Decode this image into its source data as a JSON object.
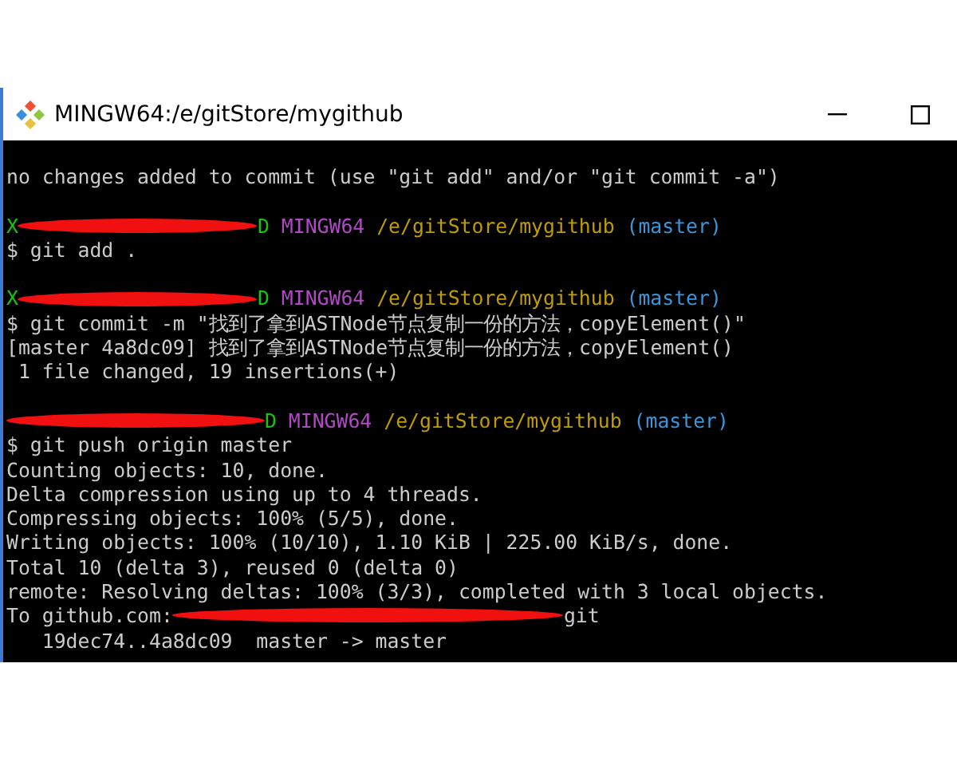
{
  "window": {
    "title": "MINGW64:/e/gitStore/mygithub"
  },
  "terminal": {
    "lines": [
      {
        "kind": "text",
        "segments": [
          {
            "kind": "text",
            "text": "no changes added to commit (use \"git add\" and/or \"git commit -a\")",
            "color": "#cccccc"
          }
        ]
      },
      {
        "kind": "blank"
      },
      {
        "kind": "text",
        "segments": [
          {
            "kind": "text",
            "text": "X",
            "color": "#16c60c"
          },
          {
            "kind": "redaction"
          },
          {
            "kind": "text",
            "text": "D",
            "color": "#16c60c"
          },
          {
            "kind": "text",
            "text": " MINGW64",
            "color": "#b148c6"
          },
          {
            "kind": "text",
            "text": " /e/gitStore/mygithub",
            "color": "#c19c00"
          },
          {
            "kind": "text",
            "text": " (master)",
            "color": "#3a96dd"
          }
        ]
      },
      {
        "kind": "text",
        "segments": [
          {
            "kind": "text",
            "text": "$ git add .",
            "color": "#cccccc"
          }
        ]
      },
      {
        "kind": "blank"
      },
      {
        "kind": "text",
        "segments": [
          {
            "kind": "text",
            "text": "X",
            "color": "#16c60c"
          },
          {
            "kind": "redaction"
          },
          {
            "kind": "text",
            "text": "D",
            "color": "#16c60c"
          },
          {
            "kind": "text",
            "text": " MINGW64",
            "color": "#b148c6"
          },
          {
            "kind": "text",
            "text": " /e/gitStore/mygithub",
            "color": "#c19c00"
          },
          {
            "kind": "text",
            "text": " (master)",
            "color": "#3a96dd"
          }
        ]
      },
      {
        "kind": "text",
        "segments": [
          {
            "kind": "text",
            "text": "$ git commit -m \"找到了拿到ASTNode节点复制一份的方法，copyElement()\"",
            "color": "#cccccc"
          }
        ]
      },
      {
        "kind": "text",
        "segments": [
          {
            "kind": "text",
            "text": "[master 4a8dc09] 找到了拿到ASTNode节点复制一份的方法，copyElement()",
            "color": "#cccccc"
          }
        ]
      },
      {
        "kind": "text",
        "segments": [
          {
            "kind": "text",
            "text": " 1 file changed, 19 insertions(+)",
            "color": "#cccccc"
          }
        ]
      },
      {
        "kind": "blank"
      },
      {
        "kind": "text",
        "segments": [
          {
            "kind": "redaction"
          },
          {
            "kind": "text",
            "text": "D",
            "color": "#16c60c"
          },
          {
            "kind": "text",
            "text": " MINGW64",
            "color": "#b148c6"
          },
          {
            "kind": "text",
            "text": " /e/gitStore/mygithub",
            "color": "#c19c00"
          },
          {
            "kind": "text",
            "text": " (master)",
            "color": "#3a96dd"
          }
        ]
      },
      {
        "kind": "text",
        "segments": [
          {
            "kind": "text",
            "text": "$ git push origin master",
            "color": "#cccccc"
          }
        ]
      },
      {
        "kind": "text",
        "segments": [
          {
            "kind": "text",
            "text": "Counting objects: 10, done.",
            "color": "#cccccc"
          }
        ]
      },
      {
        "kind": "text",
        "segments": [
          {
            "kind": "text",
            "text": "Delta compression using up to 4 threads.",
            "color": "#cccccc"
          }
        ]
      },
      {
        "kind": "text",
        "segments": [
          {
            "kind": "text",
            "text": "Compressing objects: 100% (5/5), done.",
            "color": "#cccccc"
          }
        ]
      },
      {
        "kind": "text",
        "segments": [
          {
            "kind": "text",
            "text": "Writing objects: 100% (10/10), 1.10 KiB | 225.00 KiB/s, done.",
            "color": "#cccccc"
          }
        ]
      },
      {
        "kind": "text",
        "segments": [
          {
            "kind": "text",
            "text": "Total 10 (delta 3), reused 0 (delta 0)",
            "color": "#cccccc"
          }
        ]
      },
      {
        "kind": "text",
        "segments": [
          {
            "kind": "text",
            "text": "remote: Resolving deltas: 100% (3/3), completed with 3 local objects.",
            "color": "#cccccc"
          }
        ]
      },
      {
        "kind": "text",
        "segments": [
          {
            "kind": "text",
            "text": "To github.com:",
            "color": "#cccccc"
          },
          {
            "kind": "redaction"
          },
          {
            "kind": "text",
            "text": "git",
            "color": "#cccccc"
          }
        ]
      },
      {
        "kind": "text",
        "segments": [
          {
            "kind": "text",
            "text": "   19dec74..4a8dc09  master -> master",
            "color": "#cccccc"
          }
        ]
      }
    ]
  }
}
